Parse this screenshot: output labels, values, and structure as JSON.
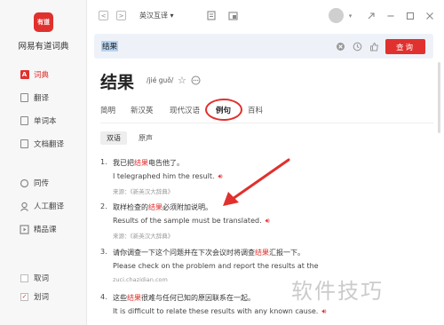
{
  "app": {
    "logo_text": "有道",
    "name": "网易有道词典"
  },
  "sidebar": {
    "items": [
      {
        "label": "词典",
        "icon": "dictionary-icon",
        "active": true
      },
      {
        "label": "翻译",
        "icon": "translate-icon"
      },
      {
        "label": "单词本",
        "icon": "wordbook-icon"
      },
      {
        "label": "文档翻译",
        "icon": "document-translate-icon"
      },
      {
        "label": "同传",
        "icon": "simultaneous-icon"
      },
      {
        "label": "人工翻译",
        "icon": "human-translate-icon"
      },
      {
        "label": "精品课",
        "icon": "course-icon"
      }
    ],
    "options": [
      {
        "label": "取词",
        "checked": false
      },
      {
        "label": "划词",
        "checked": true
      }
    ]
  },
  "topbar": {
    "mode": "英汉互译",
    "back": "<",
    "forward": ">"
  },
  "search": {
    "query": "结果",
    "button": "查询"
  },
  "entry": {
    "word": "结果",
    "phonetic": "/jié guǒ/"
  },
  "tabs": [
    {
      "label": "简明"
    },
    {
      "label": "新汉英"
    },
    {
      "label": "现代汉语"
    },
    {
      "label": "例句",
      "active": true
    },
    {
      "label": "百科"
    }
  ],
  "subtabs": [
    {
      "label": "双语",
      "active": true
    },
    {
      "label": "原声"
    }
  ],
  "examples": [
    {
      "num": "1.",
      "cn_before": "我已把",
      "cn_hl": "结果",
      "cn_after": "电告他了。",
      "en": "I telegraphed him the result.",
      "src": "来源：《新英汉大辞典》"
    },
    {
      "num": "2.",
      "cn_before": "取样检查的",
      "cn_hl": "结果",
      "cn_after": "必须附加说明。",
      "en": "Results of the sample must be translated.",
      "src": "来源：《新英汉大辞典》"
    },
    {
      "num": "3.",
      "cn_before": "请你调查一下这个问题并在下次会议时将调查",
      "cn_hl": "结果",
      "cn_after": "汇报一下。",
      "en": "Please check on the problem and report the results at the",
      "src": "zuci.chazidian.com"
    },
    {
      "num": "4.",
      "cn_before": "这些",
      "cn_hl": "结果",
      "cn_after": "很难与任何已知的原因联系在一起。",
      "en": "It is difficult to relate these results with any known cause.",
      "src": ""
    }
  ],
  "watermark": "软件技巧",
  "colors": {
    "accent": "#e0312e",
    "search_bg": "#eef2f8"
  }
}
